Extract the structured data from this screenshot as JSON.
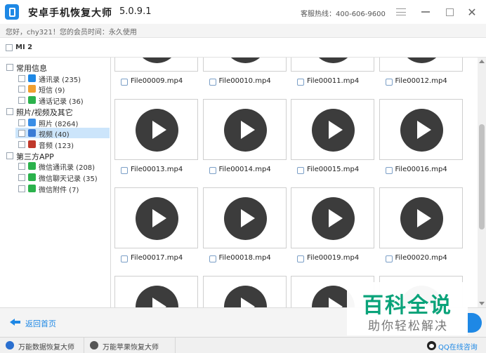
{
  "app": {
    "title": "安卓手机恢复大师",
    "version": "5.0.9.1",
    "hotline": "客服热线：400-606-9600"
  },
  "user_bar": {
    "text": "您好，chy321！您的会员时间：永久使用"
  },
  "device": {
    "name": "MI 2"
  },
  "sidebar": {
    "groups": [
      {
        "label": "常用信息",
        "items": [
          {
            "label": "通讯录 (235)",
            "icon": "contacts-icon",
            "color": "#1e88e5"
          },
          {
            "label": "短信 (9)",
            "icon": "sms-icon",
            "color": "#f0a030"
          },
          {
            "label": "通话记录 (36)",
            "icon": "phone-icon",
            "color": "#2bb24c"
          }
        ]
      },
      {
        "label": "照片/视频及其它",
        "items": [
          {
            "label": "照片 (8264)",
            "icon": "photo-icon",
            "color": "#3a8ee6"
          },
          {
            "label": "视频 (40)",
            "icon": "video-icon",
            "color": "#3a7bd5"
          },
          {
            "label": "音频 (123)",
            "icon": "audio-icon",
            "color": "#c0392b"
          }
        ]
      },
      {
        "label": "第三方APP",
        "items": [
          {
            "label": "微信通讯录 (208)",
            "icon": "wechat-icon",
            "color": "#2bb24c"
          },
          {
            "label": "微信聊天记录 (35)",
            "icon": "wechat-icon",
            "color": "#2bb24c"
          },
          {
            "label": "微信附件 (7)",
            "icon": "wechat-icon",
            "color": "#2bb24c"
          }
        ]
      }
    ],
    "selected_item": "视频 (40)"
  },
  "files": [
    "File00009.mp4",
    "File00010.mp4",
    "File00011.mp4",
    "File00012.mp4",
    "File00013.mp4",
    "File00014.mp4",
    "File00015.mp4",
    "File00016.mp4",
    "File00017.mp4",
    "File00018.mp4",
    "File00019.mp4",
    "File00020.mp4"
  ],
  "footer": {
    "back_label": "返回首页"
  },
  "watermark": {
    "title": "百科全说",
    "subtitle": "助你轻松解决"
  },
  "status_bar": {
    "items": [
      "万能数据恢复大师",
      "万能苹果恢复大师"
    ],
    "qq_label": "QQ在线咨询"
  },
  "colors": {
    "accent": "#1e88e5",
    "selected_row": "#cce5fb",
    "watermark_green": "#0aa37a"
  }
}
